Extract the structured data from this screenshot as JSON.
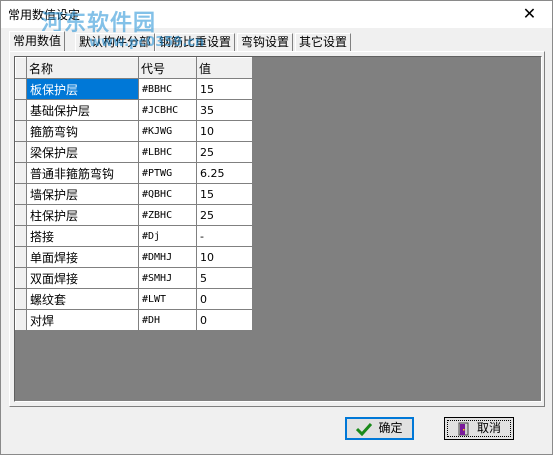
{
  "window": {
    "title": "常用数值设定",
    "close_glyph": "✕"
  },
  "watermark": {
    "text": "河东软件园",
    "url": "www.pc0359.cn"
  },
  "tabs": [
    {
      "label": "常用数值"
    },
    {
      "label": "默认构件分部"
    },
    {
      "label": "钢筋比重设置"
    },
    {
      "label": "弯钩设置"
    },
    {
      "label": "其它设置"
    }
  ],
  "grid": {
    "headers": {
      "name": "名称",
      "code": "代号",
      "value": "值"
    },
    "rows": [
      {
        "name": "板保护层",
        "code": "#BBHC",
        "value": "15"
      },
      {
        "name": "基础保护层",
        "code": "#JCBHC",
        "value": "35"
      },
      {
        "name": "箍筋弯钩",
        "code": "#KJWG",
        "value": "10"
      },
      {
        "name": "梁保护层",
        "code": "#LBHC",
        "value": "25"
      },
      {
        "name": "普通非箍筋弯钩",
        "code": "#PTWG",
        "value": "6.25"
      },
      {
        "name": "墙保护层",
        "code": "#QBHC",
        "value": "15"
      },
      {
        "name": "柱保护层",
        "code": "#ZBHC",
        "value": "25"
      },
      {
        "name": "搭接",
        "code": "#Dj",
        "value": "-"
      },
      {
        "name": "单面焊接",
        "code": "#DMHJ",
        "value": "10"
      },
      {
        "name": "双面焊接",
        "code": "#SMHJ",
        "value": "5"
      },
      {
        "name": "螺纹套",
        "code": "#LWT",
        "value": "0"
      },
      {
        "name": "对焊",
        "code": "#DH",
        "value": "0"
      }
    ],
    "selected_row": 0
  },
  "buttons": {
    "ok": "确定",
    "cancel": "取消"
  },
  "colors": {
    "selection": "#0078d7",
    "watermark": "#1e8fd6"
  }
}
